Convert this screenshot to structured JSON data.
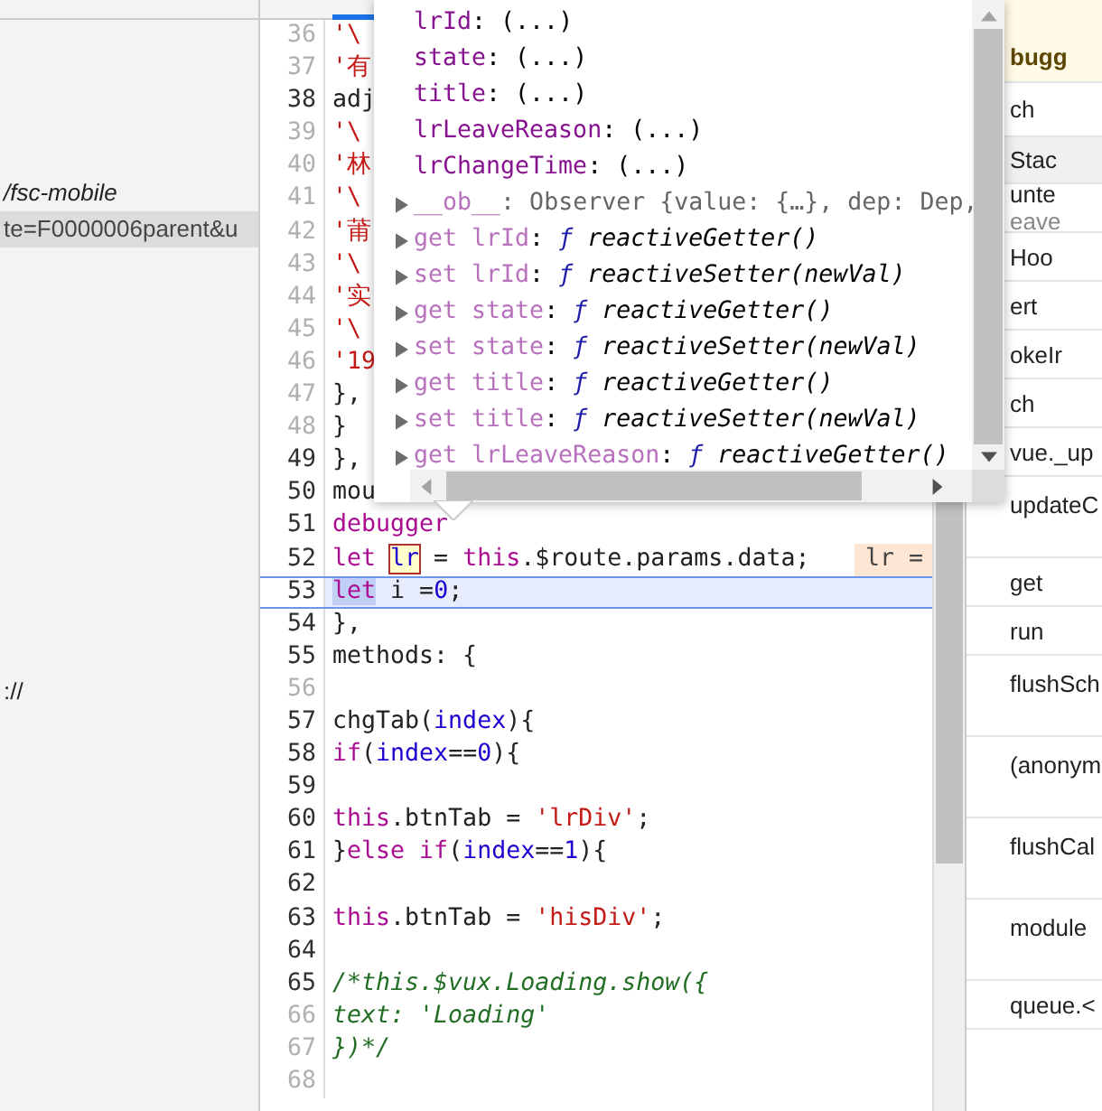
{
  "navigator": {
    "items": [
      {
        "text": "/fsc-mobile",
        "selected": false,
        "italic": true
      },
      {
        "text": "te=F0000006parent&u",
        "selected": true,
        "italic": false
      },
      {
        "text": "://",
        "selected": false,
        "italic": false
      }
    ]
  },
  "editor": {
    "lines": [
      {
        "number": "36",
        "executable": false,
        "current": false,
        "tokens": [
          {
            "kind": "string",
            "text": "'\\"
          }
        ]
      },
      {
        "number": "37",
        "executable": false,
        "current": false,
        "tokens": [
          {
            "kind": "string",
            "text": "'有"
          }
        ]
      },
      {
        "number": "38",
        "executable": true,
        "current": false,
        "tokens": [
          {
            "kind": "plain",
            "text": "adj"
          }
        ]
      },
      {
        "number": "39",
        "executable": false,
        "current": false,
        "tokens": [
          {
            "kind": "string",
            "text": "'\\"
          }
        ]
      },
      {
        "number": "40",
        "executable": false,
        "current": false,
        "tokens": [
          {
            "kind": "string",
            "text": "'林"
          }
        ]
      },
      {
        "number": "41",
        "executable": false,
        "current": false,
        "tokens": [
          {
            "kind": "string",
            "text": "'\\"
          }
        ]
      },
      {
        "number": "42",
        "executable": false,
        "current": false,
        "tokens": [
          {
            "kind": "string",
            "text": "'莆"
          }
        ]
      },
      {
        "number": "43",
        "executable": false,
        "current": false,
        "tokens": [
          {
            "kind": "string",
            "text": "'\\"
          }
        ]
      },
      {
        "number": "44",
        "executable": false,
        "current": false,
        "tokens": [
          {
            "kind": "string",
            "text": "'实"
          }
        ]
      },
      {
        "number": "45",
        "executable": false,
        "current": false,
        "tokens": [
          {
            "kind": "string",
            "text": "'\\"
          }
        ]
      },
      {
        "number": "46",
        "executable": false,
        "current": false,
        "tokens": [
          {
            "kind": "string",
            "text": "'19"
          }
        ]
      },
      {
        "number": "47",
        "executable": false,
        "current": false,
        "tokens": [
          {
            "kind": "plain",
            "text": "},"
          }
        ]
      },
      {
        "number": "48",
        "executable": false,
        "current": false,
        "tokens": [
          {
            "kind": "plain",
            "text": "}"
          }
        ]
      },
      {
        "number": "49",
        "executable": true,
        "current": false,
        "tokens": [
          {
            "kind": "plain",
            "text": "},"
          }
        ]
      },
      {
        "number": "50",
        "executable": true,
        "current": false,
        "tokens": [
          {
            "kind": "plain",
            "text": "mou"
          }
        ]
      },
      {
        "number": "51",
        "executable": true,
        "current": false,
        "tokens": [
          {
            "kind": "keyword",
            "text": "debugger"
          }
        ]
      },
      {
        "number": "52",
        "executable": true,
        "current": false,
        "inline_value": "lr =",
        "tokens": [
          {
            "kind": "keyword",
            "text": "let "
          },
          {
            "kind": "hovered",
            "text": "lr"
          },
          {
            "kind": "plain",
            "text": " = "
          },
          {
            "kind": "keyword",
            "text": "this"
          },
          {
            "kind": "plain",
            "text": ".$route.params.data;"
          }
        ]
      },
      {
        "number": "53",
        "executable": true,
        "current": true,
        "tokens": [
          {
            "kind": "execution",
            "text": "let"
          },
          {
            "kind": "plain",
            "text": " i ="
          },
          {
            "kind": "number",
            "text": "0"
          },
          {
            "kind": "plain",
            "text": ";"
          }
        ]
      },
      {
        "number": "54",
        "executable": true,
        "current": false,
        "tokens": [
          {
            "kind": "plain",
            "text": "},"
          }
        ]
      },
      {
        "number": "55",
        "executable": true,
        "current": false,
        "tokens": [
          {
            "kind": "plain",
            "text": "methods: {"
          }
        ]
      },
      {
        "number": "56",
        "executable": false,
        "current": false
      },
      {
        "number": "57",
        "executable": true,
        "current": false,
        "tokens": [
          {
            "kind": "plain",
            "text": "chgTab("
          },
          {
            "kind": "param",
            "text": "index"
          },
          {
            "kind": "plain",
            "text": "){"
          }
        ]
      },
      {
        "number": "58",
        "executable": true,
        "current": false,
        "tokens": [
          {
            "kind": "keyword",
            "text": "if"
          },
          {
            "kind": "plain",
            "text": "("
          },
          {
            "kind": "param",
            "text": "index"
          },
          {
            "kind": "plain",
            "text": "=="
          },
          {
            "kind": "number",
            "text": "0"
          },
          {
            "kind": "plain",
            "text": "){"
          }
        ]
      },
      {
        "number": "59",
        "executable": true,
        "current": false
      },
      {
        "number": "60",
        "executable": true,
        "current": false,
        "tokens": [
          {
            "kind": "keyword",
            "text": "this"
          },
          {
            "kind": "plain",
            "text": ".btnTab = "
          },
          {
            "kind": "string",
            "text": "'lrDiv'"
          },
          {
            "kind": "plain",
            "text": ";"
          }
        ]
      },
      {
        "number": "61",
        "executable": true,
        "current": false,
        "tokens": [
          {
            "kind": "plain",
            "text": "}"
          },
          {
            "kind": "keyword",
            "text": "else if"
          },
          {
            "kind": "plain",
            "text": "("
          },
          {
            "kind": "param",
            "text": "index"
          },
          {
            "kind": "plain",
            "text": "=="
          },
          {
            "kind": "number",
            "text": "1"
          },
          {
            "kind": "plain",
            "text": "){"
          }
        ]
      },
      {
        "number": "62",
        "executable": true,
        "current": false
      },
      {
        "number": "63",
        "executable": true,
        "current": false,
        "tokens": [
          {
            "kind": "keyword",
            "text": "this"
          },
          {
            "kind": "plain",
            "text": ".btnTab = "
          },
          {
            "kind": "string",
            "text": "'hisDiv'"
          },
          {
            "kind": "plain",
            "text": ";"
          }
        ]
      },
      {
        "number": "64",
        "executable": true,
        "current": false
      },
      {
        "number": "65",
        "executable": true,
        "current": false,
        "tokens": [
          {
            "kind": "comment",
            "text": "/*this.$vux.Loading.show({"
          }
        ]
      },
      {
        "number": "66",
        "executable": false,
        "current": false,
        "tokens": [
          {
            "kind": "comment",
            "text": "text: 'Loading'"
          }
        ]
      },
      {
        "number": "67",
        "executable": false,
        "current": false,
        "tokens": [
          {
            "kind": "comment",
            "text": "})*/"
          }
        ]
      },
      {
        "number": "68",
        "executable": false,
        "current": false
      }
    ]
  },
  "popover": {
    "rows": [
      {
        "kind": "property",
        "key": "lrId",
        "sep": ":",
        "value": "(...)"
      },
      {
        "kind": "property",
        "key": "state",
        "sep": ":",
        "value": "(...)"
      },
      {
        "kind": "property",
        "key": "title",
        "sep": ":",
        "value": "(...)"
      },
      {
        "kind": "property",
        "key": "lrLeaveReason",
        "sep": ":",
        "value": "(...)"
      },
      {
        "kind": "property",
        "key": "lrChangeTime",
        "sep": ":",
        "value": "(...)"
      },
      {
        "kind": "object",
        "key": "__ob__",
        "sep": ":",
        "value": "Observer {value: {…}, dep: Dep,"
      },
      {
        "kind": "accessor",
        "key": "get lrId",
        "sep": ":",
        "fn": "ƒ",
        "value": "reactiveGetter()"
      },
      {
        "kind": "accessor",
        "key": "set lrId",
        "sep": ":",
        "fn": "ƒ",
        "value": "reactiveSetter(newVal)"
      },
      {
        "kind": "accessor",
        "key": "get state",
        "sep": ":",
        "fn": "ƒ",
        "value": "reactiveGetter()"
      },
      {
        "kind": "accessor",
        "key": "set state",
        "sep": ":",
        "fn": "ƒ",
        "value": "reactiveSetter(newVal)"
      },
      {
        "kind": "accessor",
        "key": "get title",
        "sep": ":",
        "fn": "ƒ",
        "value": "reactiveGetter()"
      },
      {
        "kind": "accessor",
        "key": "set title",
        "sep": ":",
        "fn": "ƒ",
        "value": "reactiveSetter(newVal)"
      },
      {
        "kind": "accessor",
        "key": "get lrLeaveReason",
        "sep": ":",
        "fn": "ƒ",
        "value": "reactiveGetter()"
      }
    ]
  },
  "sidebar": {
    "rows": [
      {
        "kind": "banner",
        "text": "bugg"
      },
      {
        "kind": "pane",
        "text": "ch"
      },
      {
        "kind": "header",
        "text": "Stac"
      },
      {
        "kind": "frame",
        "text": "unte",
        "location": "eave"
      },
      {
        "kind": "frame",
        "text": "Hoo"
      },
      {
        "kind": "frame",
        "text": "ert"
      },
      {
        "kind": "frame",
        "text": "okeIr"
      },
      {
        "kind": "frame",
        "text": "ch"
      },
      {
        "kind": "frame",
        "text": "vue._up"
      },
      {
        "kind": "tall",
        "text": "updateC"
      },
      {
        "kind": "frame",
        "text": "get"
      },
      {
        "kind": "frame",
        "text": "run"
      },
      {
        "kind": "tall",
        "text": "flushSch"
      },
      {
        "kind": "tall",
        "text": "(anonym"
      },
      {
        "kind": "tall",
        "text": "flushCal"
      },
      {
        "kind": "tall",
        "text": "module"
      },
      {
        "kind": "frame",
        "text": "queue.<"
      }
    ]
  }
}
